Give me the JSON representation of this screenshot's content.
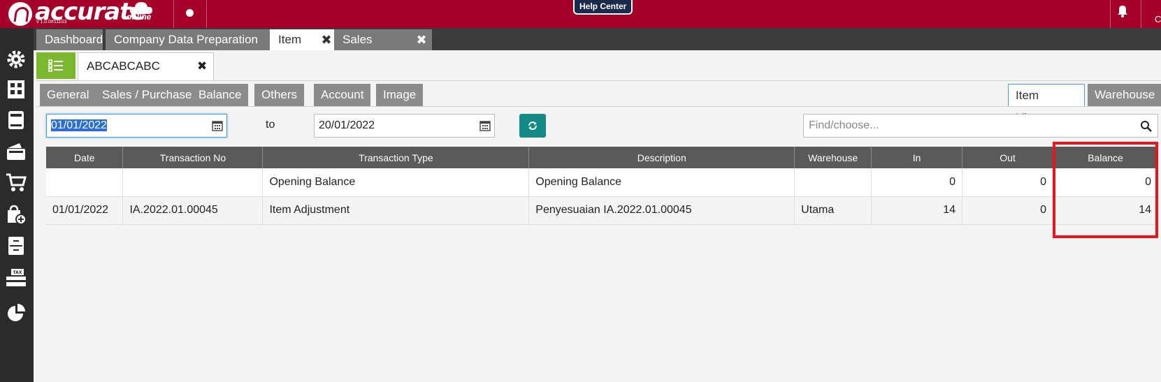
{
  "colors": {
    "header": "#a40029",
    "sidebar": "#2b2b2b",
    "list_button": "#7cb82f",
    "refresh_button": "#138a86",
    "highlight": "#e8141e"
  },
  "header": {
    "brand": "accurate",
    "brand_suffix": "online",
    "version": "v 1.0.0#11103",
    "help_center": "Help Center",
    "user_initial": "C"
  },
  "sidebar": {
    "icons": [
      "settings-gear-icon",
      "company-building-icon",
      "ledger-book-icon",
      "wallet-icon",
      "shopping-cart-icon",
      "shopping-bag-add-icon",
      "inventory-cabinet-icon",
      "tax-icon",
      "pie-chart-icon"
    ]
  },
  "module_tabs": [
    {
      "label": "Dashboard",
      "active": false,
      "closable": false
    },
    {
      "label": "Company Data Preparation",
      "active": false,
      "closable": false
    },
    {
      "label": "Item",
      "active": true,
      "closable": true
    },
    {
      "label": "Sales Order",
      "active": false,
      "closable": true
    }
  ],
  "record": {
    "tab_label": "ABCABCABC"
  },
  "subtabs": {
    "left": [
      "General",
      "Sales / Purchase",
      "Balance",
      "Others",
      "Account",
      "Image"
    ],
    "right": [
      "Item History",
      "Warehouse"
    ],
    "active": "Item History"
  },
  "filter": {
    "from_date": "01/01/2022",
    "to_label": "to",
    "to_date": "20/01/2022",
    "search_placeholder": "Find/choose..."
  },
  "table": {
    "columns": [
      "Date",
      "Transaction No",
      "Transaction Type",
      "Description",
      "Warehouse",
      "In",
      "Out",
      "Balance"
    ],
    "rows": [
      {
        "date": "",
        "transaction_no": "",
        "transaction_type": "Opening Balance",
        "description": "Opening Balance",
        "warehouse": "",
        "in": "0",
        "out": "0",
        "balance": "0"
      },
      {
        "date": "01/01/2022",
        "transaction_no": "IA.2022.01.00045",
        "transaction_type": "Item Adjustment",
        "description": "Penyesuaian IA.2022.01.00045",
        "warehouse": "Utama",
        "in": "14",
        "out": "0",
        "balance": "14"
      }
    ]
  }
}
